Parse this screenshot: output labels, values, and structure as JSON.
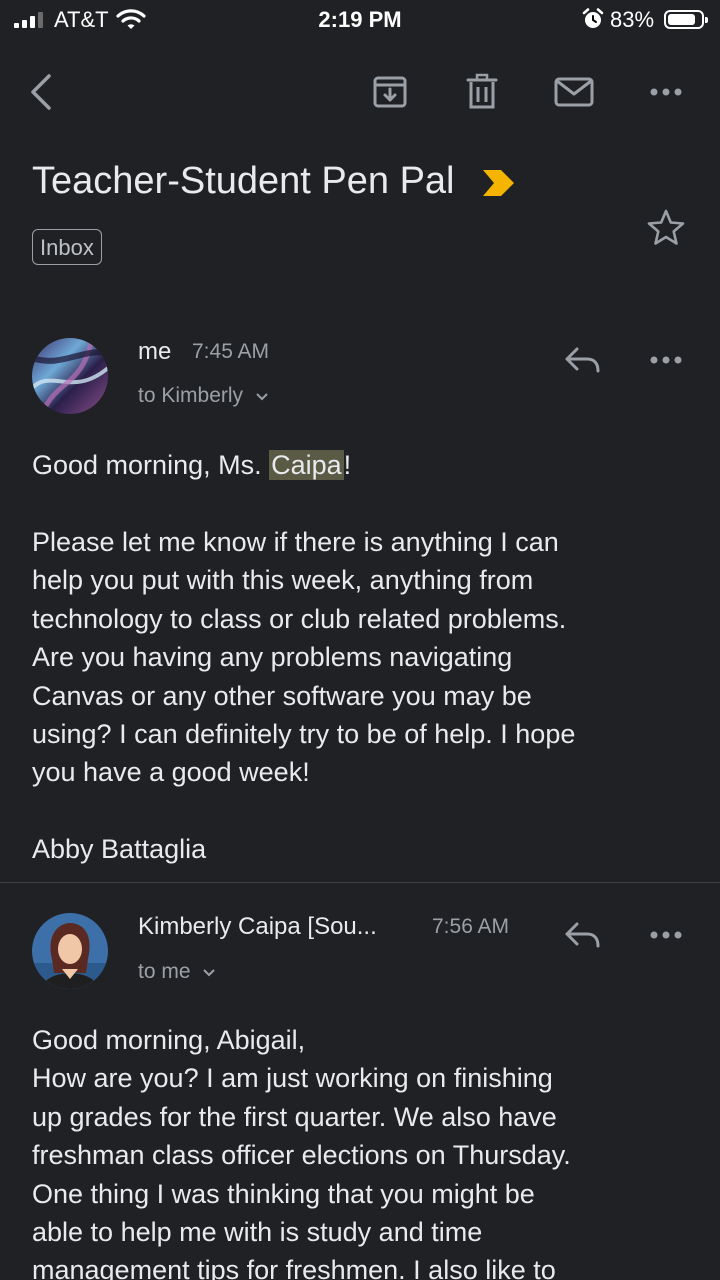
{
  "status_bar": {
    "carrier": "AT&T",
    "time": "2:19 PM",
    "battery_percent": "83%",
    "battery_level": 0.83,
    "icons": [
      "cellular-signal-icon",
      "wifi-icon",
      "alarm-icon",
      "battery-icon"
    ]
  },
  "toolbar": {
    "back": "back-arrow-icon",
    "actions": [
      "archive-icon",
      "trash-icon",
      "mark-unread-icon",
      "more-icon"
    ]
  },
  "thread": {
    "subject": "Teacher-Student Pen Pal",
    "importance_marker_color": "#f4b400",
    "label": "Inbox"
  },
  "messages": [
    {
      "sender": "me",
      "time": "7:45 AM",
      "recipient": "to Kimberly",
      "greeting_prefix": "Good morning, Ms. ",
      "greeting_highlight": "Caipa",
      "greeting_suffix": "!",
      "body": "Please let me know if there is anything I can\nhelp you put with this week, anything from\ntechnology to class or club related problems.\nAre you having any problems navigating\nCanvas or any other software you may be\nusing? I can definitely try to be of help. I hope\nyou have a good week!",
      "signature": "Abby Battaglia"
    },
    {
      "sender": "Kimberly Caipa [Sou...",
      "time": "7:56 AM",
      "recipient": "to me",
      "body": "Good morning, Abigail,\nHow are you? I am just working on finishing\nup grades for the first quarter. We also have\nfreshman class officer elections on Thursday.\nOne thing I was thinking that you might be\nable to help me with is study and time\nmanagement tips for freshmen. I also like to"
    }
  ],
  "colors": {
    "background": "#202124",
    "text": "#e8eaed",
    "secondary_text": "#9aa0a6",
    "highlight": "#5b5a45"
  }
}
